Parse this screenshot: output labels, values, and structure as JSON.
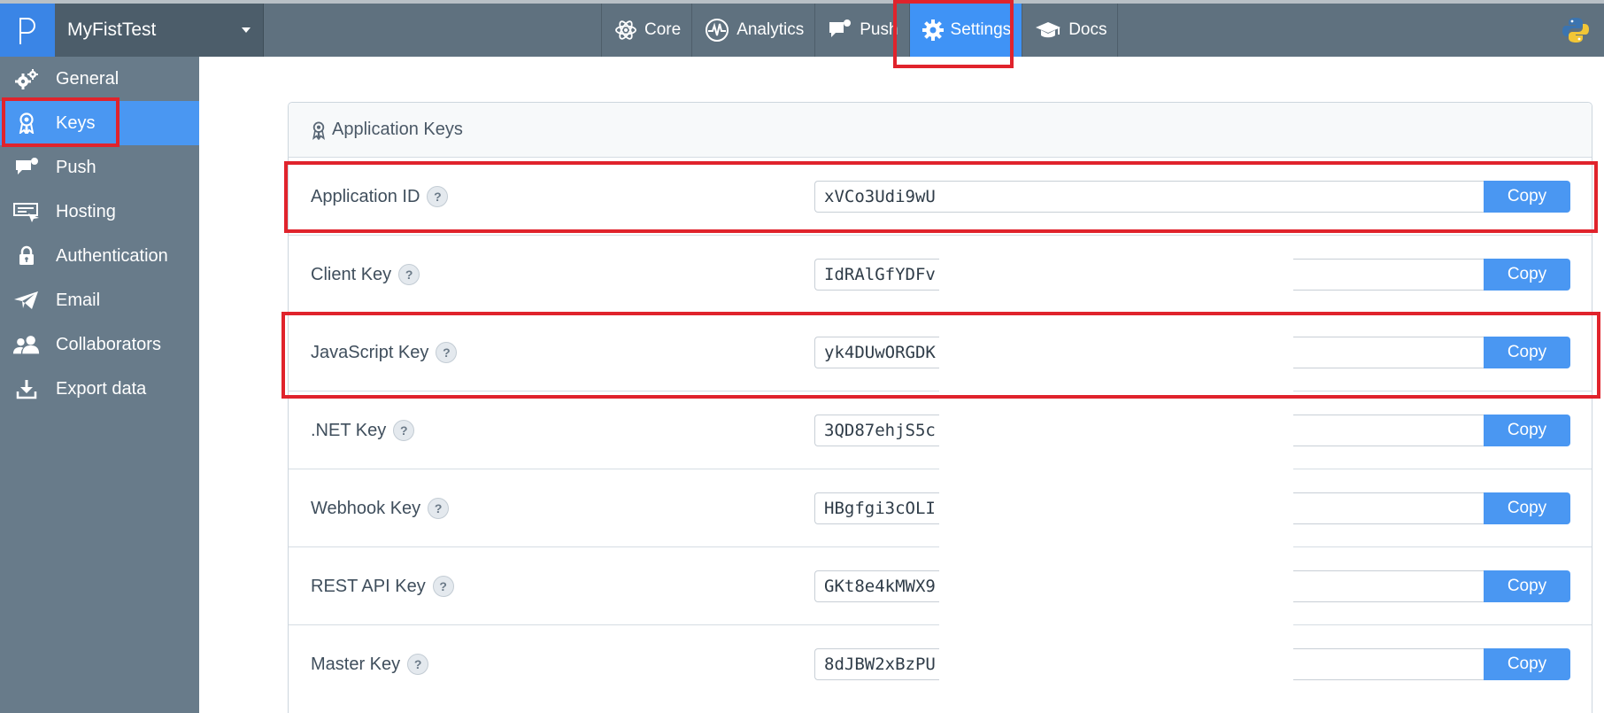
{
  "app": {
    "name": "MyFistTest"
  },
  "nav": [
    {
      "label": "Core",
      "icon": "atom-icon",
      "active": false
    },
    {
      "label": "Analytics",
      "icon": "pulse-icon",
      "active": false
    },
    {
      "label": "Push",
      "icon": "speech-bubble-icon",
      "active": false
    },
    {
      "label": "Settings",
      "icon": "gear-icon",
      "active": true
    },
    {
      "label": "Docs",
      "icon": "graduation-cap-icon",
      "active": false
    }
  ],
  "sidebar": [
    {
      "label": "General",
      "icon": "gears-icon",
      "active": false
    },
    {
      "label": "Keys",
      "icon": "key-ribbon-icon",
      "active": true
    },
    {
      "label": "Push",
      "icon": "speech-bubble-icon",
      "active": false
    },
    {
      "label": "Hosting",
      "icon": "hosting-icon",
      "active": false
    },
    {
      "label": "Authentication",
      "icon": "lock-icon",
      "active": false
    },
    {
      "label": "Email",
      "icon": "paper-plane-icon",
      "active": false
    },
    {
      "label": "Collaborators",
      "icon": "users-icon",
      "active": false
    },
    {
      "label": "Export data",
      "icon": "download-icon",
      "active": false
    }
  ],
  "panel": {
    "title": "Application Keys",
    "help_symbol": "?",
    "copy_label": "Copy",
    "keys": [
      {
        "label": "Application ID",
        "value": "xVCo3Udi9wU"
      },
      {
        "label": "Client Key",
        "value": "IdRAlGfYDFv"
      },
      {
        "label": "JavaScript Key",
        "value": "yk4DUwORGDK"
      },
      {
        "label": ".NET Key",
        "value": "3QD87ehjS5c"
      },
      {
        "label": "Webhook Key",
        "value": "HBgfgi3cOLI"
      },
      {
        "label": "REST API Key",
        "value": "GKt8e4kMWX9"
      },
      {
        "label": "Master Key",
        "value": "8dJBW2xBzPU"
      }
    ]
  },
  "colors": {
    "accent": "#4a97f2",
    "highlight": "#e0232c",
    "sidebar": "#687b8a",
    "topbar": "#5f717f"
  }
}
